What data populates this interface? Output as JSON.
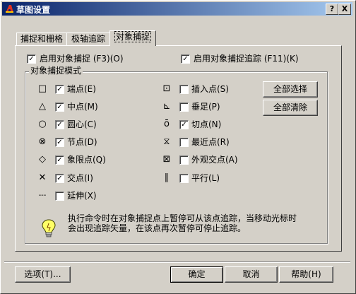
{
  "window": {
    "title": "草图设置",
    "help_btn": "?",
    "close_btn": "X"
  },
  "tabs": [
    {
      "label": "捕捉和栅格",
      "active": false
    },
    {
      "label": "极轴追踪",
      "active": false
    },
    {
      "label": "对象捕捉",
      "active": true
    }
  ],
  "top_options": {
    "enable_snap": {
      "label": "启用对象捕捉 (F3)(O)",
      "checked": true
    },
    "enable_tracking": {
      "label": "启用对象捕捉追踪 (F11)(K)",
      "checked": true
    }
  },
  "group": {
    "title": "对象捕捉模式"
  },
  "modes_left": [
    {
      "label": "端点(E)",
      "checked": true,
      "symbol": "□"
    },
    {
      "label": "中点(M)",
      "checked": true,
      "symbol": "△"
    },
    {
      "label": "圆心(C)",
      "checked": true,
      "symbol": "○"
    },
    {
      "label": "节点(D)",
      "checked": true,
      "symbol": "⊗"
    },
    {
      "label": "象限点(Q)",
      "checked": true,
      "symbol": "◇"
    },
    {
      "label": "交点(I)",
      "checked": true,
      "symbol": "✕"
    },
    {
      "label": "延伸(X)",
      "checked": false,
      "symbol": "---"
    }
  ],
  "modes_right": [
    {
      "label": "插入点(S)",
      "checked": false,
      "symbol": "⊡"
    },
    {
      "label": "垂足(P)",
      "checked": false,
      "symbol": "⊾"
    },
    {
      "label": "切点(N)",
      "checked": true,
      "symbol": "ō"
    },
    {
      "label": "最近点(R)",
      "checked": false,
      "symbol": "⧖"
    },
    {
      "label": "外观交点(A)",
      "checked": false,
      "symbol": "⊠"
    },
    {
      "label": "平行(L)",
      "checked": false,
      "symbol": "∥"
    }
  ],
  "buttons_side": {
    "select_all": "全部选择",
    "clear_all": "全部清除"
  },
  "tip": {
    "line1": "执行命令时在对象捕捉点上暂停可从该点追踪，当移动光标时",
    "line2": "会出现追踪矢量，在该点再次暂停可停止追踪。"
  },
  "footer": {
    "options": "选项(T)...",
    "ok": "确定",
    "cancel": "取消",
    "help": "帮助(H)"
  }
}
